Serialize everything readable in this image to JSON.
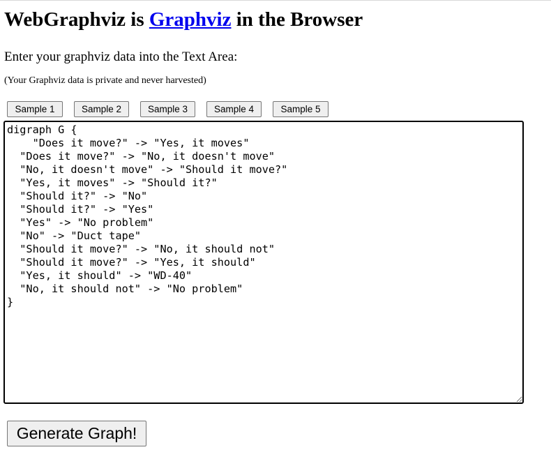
{
  "header": {
    "title_prefix": "WebGraphviz is ",
    "title_link": "Graphviz",
    "title_suffix": " in the Browser"
  },
  "instructions": "Enter your graphviz data into the Text Area:",
  "privacy_note": "(Your Graphviz data is private and never harvested)",
  "samples": [
    {
      "label": "Sample 1"
    },
    {
      "label": "Sample 2"
    },
    {
      "label": "Sample 3"
    },
    {
      "label": "Sample 4"
    },
    {
      "label": "Sample 5"
    }
  ],
  "editor": {
    "value": "digraph G {\n    \"Does it move?\" -> \"Yes, it moves\"\n  \"Does it move?\" -> \"No, it doesn't move\"\n  \"No, it doesn't move\" -> \"Should it move?\"\n  \"Yes, it moves\" -> \"Should it?\"\n  \"Should it?\" -> \"No\"\n  \"Should it?\" -> \"Yes\"\n  \"Yes\" -> \"No problem\"\n  \"No\" -> \"Duct tape\"\n  \"Should it move?\" -> \"No, it should not\"\n  \"Should it move?\" -> \"Yes, it should\"\n  \"Yes, it should\" -> \"WD-40\"\n  \"No, it should not\" -> \"No problem\"\n}"
  },
  "generate_button": "Generate Graph!",
  "colors": {
    "link": "#0000ee",
    "button_bg": "#efefef",
    "button_border": "#767676"
  }
}
